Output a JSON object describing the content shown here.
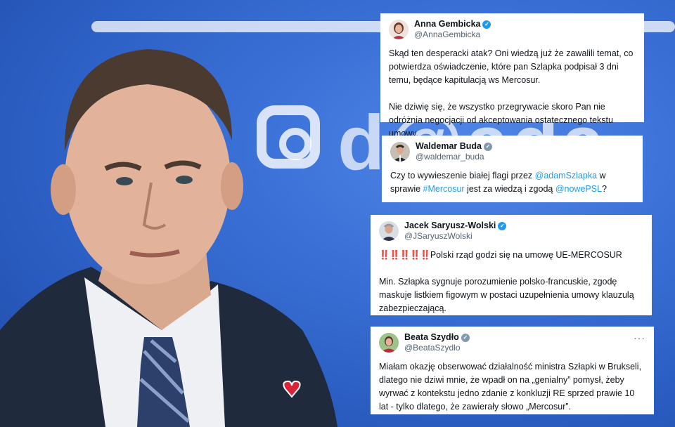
{
  "tweets": [
    {
      "name": "Anna Gembicka",
      "handle": "@AnnaGembicka",
      "verified": "blue",
      "paragraphs": [
        "Skąd ten desperacki atak? Oni wiedzą już że zawalili temat, co potwierdza oświadczenie, które pan Szlapka podpisał 3 dni temu, będące kapitulacją ws Mercosur.",
        "Nie dziwię się, że wszystko przegrywacie skoro Pan nie odróżnia negocjacji od akceptowania ostatecznego tekstu umowy."
      ]
    },
    {
      "name": "Waldemar Buda",
      "handle": "@waldemar_buda",
      "verified": "grey",
      "text_a": "Czy to wywieszenie białej flagi przez ",
      "mention_1": "@adamSzlapka",
      "text_b": " w sprawie ",
      "hashtag": "#Mercosur",
      "text_c": " jest za wiedzą i zgodą ",
      "mention_2": "@nowePSL",
      "text_d": "?"
    },
    {
      "name": "Jacek Saryusz-Wolski",
      "handle": "@JSaryuszWolski",
      "verified": "blue",
      "bangs": "‼️‼️‼️‼️‼️",
      "headline": "Polski rząd godzi się na umowę UE-MERCOSUR",
      "paragraph": "Min. Szłapka sygnuje porozumienie polsko-francuskie, zgodę maskuje listkiem figowym w postaci uzupełnienia umowy klauzulą zabezpieczającą."
    },
    {
      "name": "Beata Szydło",
      "handle": "@BeataSzydlo",
      "verified": "grey",
      "more": "···",
      "paragraph": "Miałam okazję obserwować działalność ministra Szłapki w Brukseli, dlatego nie dziwi mnie, że wpadł on na „genialny” pomysł, żeby wyrwać z kontekstu jedno zdanie z konkluzji RE sprzed prawie 10 lat - tylko dlatego, że zawierały słowo „Mercosur”."
    }
  ],
  "badge_check": "✓",
  "colors": {
    "link": "#1d9bf0",
    "background": "#2f63c8",
    "verified": "#1d9bf0"
  },
  "icons": [
    "verified-badge-icon",
    "more-options-icon"
  ]
}
